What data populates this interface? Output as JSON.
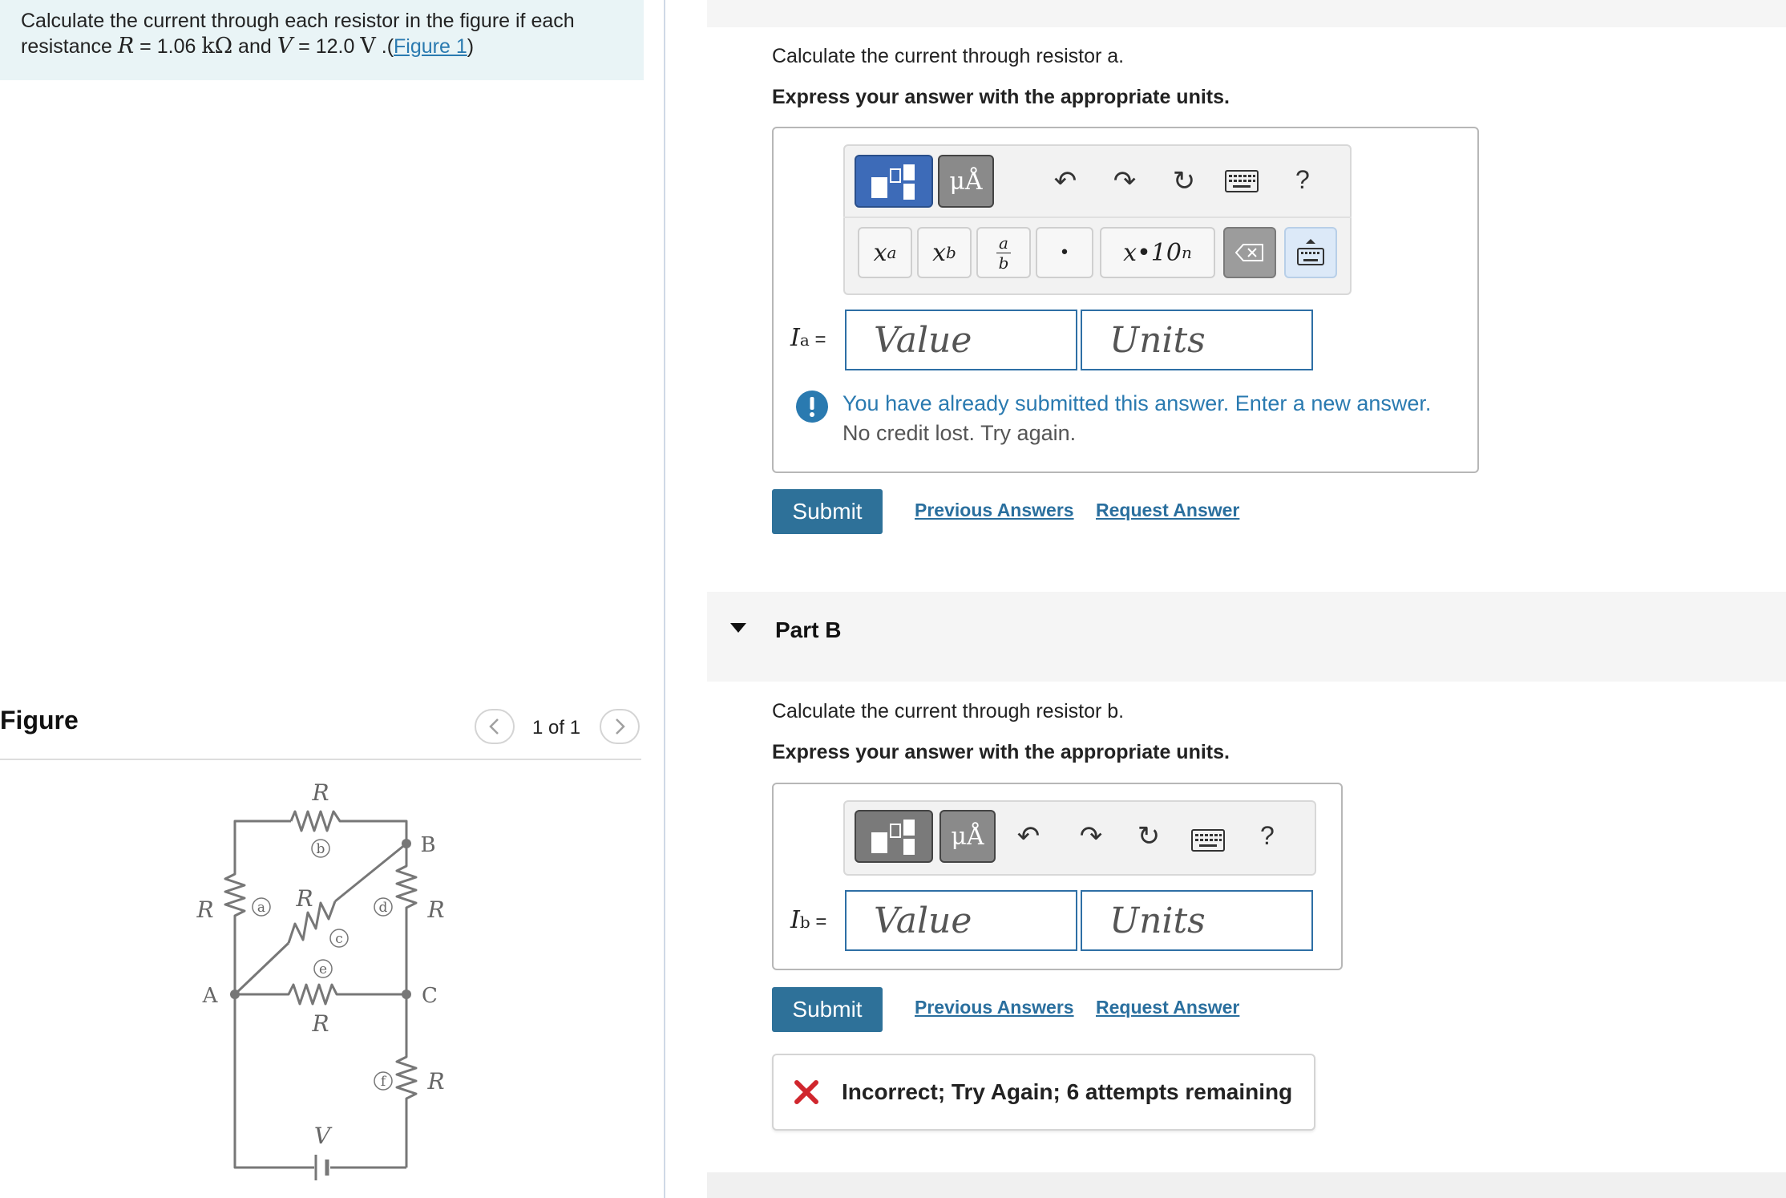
{
  "problem": {
    "text_before": "Calculate the current through each resistor in the figure if each resistance ",
    "var_R": "R",
    "eq1": " = 1.06 ",
    "unit_kohm": "kΩ",
    "and": " and ",
    "var_V": "V",
    "eq2": " = 12.0 ",
    "unit_V": "V",
    "dot_paren": " .(",
    "figure_link": "Figure 1",
    "close_paren": ")"
  },
  "figure": {
    "title": "Figure",
    "pager": "1 of 1",
    "prev_icon": "chevron-left-icon",
    "next_icon": "chevron-right-icon",
    "circuit": {
      "resistor_label": "R",
      "battery_label": "V",
      "nodes": [
        "A",
        "B",
        "C"
      ],
      "resistor_tags": [
        "a",
        "b",
        "c",
        "d",
        "e",
        "f"
      ]
    }
  },
  "part_a": {
    "question": "Calculate the current through resistor a.",
    "instruction": "Express your answer with the appropriate units.",
    "toolbar": {
      "units_label": "μÅ",
      "help_label": "?",
      "icons": [
        "templates-icon",
        "undo-icon",
        "redo-icon",
        "reset-icon",
        "keyboard-icon",
        "help-icon"
      ]
    },
    "format_buttons": {
      "superscript_base": "x",
      "superscript_exp": "a",
      "subscript_base": "x",
      "subscript_sub": "b",
      "fraction_num": "a",
      "fraction_den": "b",
      "dot": "•",
      "scientific": "x•10",
      "scientific_exp": "n"
    },
    "variable": "I",
    "variable_sub": "a",
    "equals": " =",
    "value_placeholder": "Value",
    "units_placeholder": "Units",
    "warning_line1": "You have already submitted this answer. Enter a new answer.",
    "warning_line2": "No credit lost. Try again.",
    "submit": "Submit",
    "previous_answers": "Previous Answers",
    "request_answer": "Request Answer"
  },
  "part_b": {
    "title": "Part B",
    "question": "Calculate the current through resistor b.",
    "instruction": "Express your answer with the appropriate units.",
    "toolbar": {
      "units_label": "μÅ",
      "help_label": "?"
    },
    "variable": "I",
    "variable_sub": "b",
    "equals": " =",
    "value_placeholder": "Value",
    "units_placeholder": "Units",
    "submit": "Submit",
    "previous_answers": "Previous Answers",
    "request_answer": "Request Answer",
    "feedback": "Incorrect; Try Again; 6 attempts remaining"
  },
  "colors": {
    "accent": "#2e7199",
    "link": "#2a6f9e",
    "error": "#d0262d",
    "problem_bg": "#e9f4f6"
  }
}
